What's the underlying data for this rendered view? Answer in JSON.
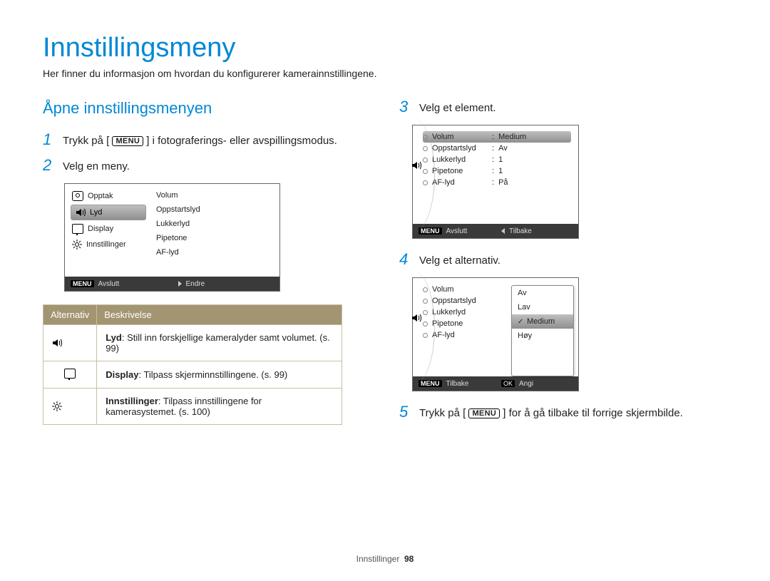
{
  "title": "Innstillingsmeny",
  "intro": "Her finner du informasjon om hvordan du konfigurerer kamerainnstillingene.",
  "section_heading": "Åpne innstillingsmenyen",
  "steps": {
    "s1a": "Trykk på [",
    "s1b": "] i fotograferings- eller avspillingsmodus.",
    "s2": "Velg en meny.",
    "s3": "Velg et element.",
    "s4": "Velg et alternativ.",
    "s5a": "Trykk på [",
    "s5b": "] for å gå tilbake til forrige skjermbilde."
  },
  "menu_badge": "MENU",
  "ok_badge": "OK",
  "screen2": {
    "left": [
      "Opptak",
      "Lyd",
      "Display",
      "Innstillinger"
    ],
    "left_selected_index": 1,
    "right": [
      "Volum",
      "Oppstartslyd",
      "Lukkerlyd",
      "Pipetone",
      "AF-lyd"
    ],
    "foot_left": "Avslutt",
    "foot_right": "Endre"
  },
  "screen3": {
    "rows": [
      {
        "k": "Volum",
        "v": "Medium"
      },
      {
        "k": "Oppstartslyd",
        "v": "Av"
      },
      {
        "k": "Lukkerlyd",
        "v": "1"
      },
      {
        "k": "Pipetone",
        "v": "1"
      },
      {
        "k": "AF-lyd",
        "v": "På"
      }
    ],
    "selected_index": 0,
    "foot_left": "Avslutt",
    "foot_right": "Tilbake"
  },
  "screen4": {
    "left": [
      "Volum",
      "Oppstartslyd",
      "Lukkerlyd",
      "Pipetone",
      "AF-lyd"
    ],
    "popup": [
      "Av",
      "Lav",
      "Medium",
      "Høy"
    ],
    "popup_selected_index": 2,
    "foot_left": "Tilbake",
    "foot_right": "Angi"
  },
  "table": {
    "h1": "Alternativ",
    "h2": "Beskrivelse",
    "rows": [
      {
        "icon": "sound",
        "b": "Lyd",
        "t": ": Still inn forskjellige kameralyder samt volumet. (s. 99)"
      },
      {
        "icon": "display",
        "b": "Display",
        "t": ": Tilpass skjerminnstillingene. (s. 99)"
      },
      {
        "icon": "gear",
        "b": "Innstillinger",
        "t": ": Tilpass innstillingene for kamerasystemet. (s. 100)"
      }
    ]
  },
  "footer": {
    "section": "Innstillinger",
    "page": "98"
  }
}
